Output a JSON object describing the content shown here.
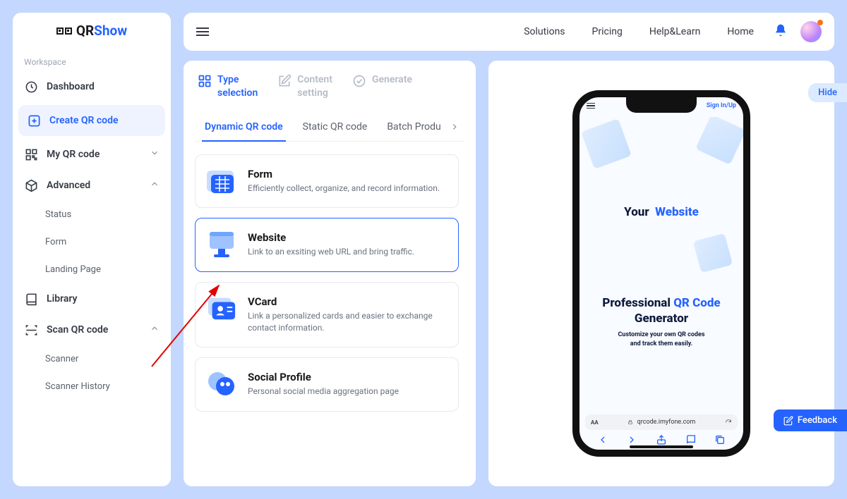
{
  "brand": {
    "name1": "QR",
    "name2": "Show"
  },
  "sidebar": {
    "workspace_label": "Workspace",
    "items": {
      "dashboard": "Dashboard",
      "create": "Create QR code",
      "myqr": "My QR code",
      "advanced": "Advanced",
      "adv_status": "Status",
      "adv_form": "Form",
      "adv_landing": "Landing Page",
      "library": "Library",
      "scan": "Scan QR code",
      "scan_scanner": "Scanner",
      "scan_history": "Scanner History"
    }
  },
  "topbar": {
    "solutions": "Solutions",
    "pricing": "Pricing",
    "help": "Help&Learn",
    "home": "Home"
  },
  "steps": {
    "s1a": "Type",
    "s1b": "selection",
    "s2a": "Content",
    "s2b": "setting",
    "s3": "Generate"
  },
  "tabs": {
    "dynamic": "Dynamic QR code",
    "static": "Static QR code",
    "batch": "Batch Produ"
  },
  "cards": {
    "form_title": "Form",
    "form_desc": "Efficiently collect, organize, and record information.",
    "website_title": "Website",
    "website_desc": "Link to an exsiting web URL and bring traffic.",
    "vcard_title": "VCard",
    "vcard_desc": "Link a personalized cards and easier to exchange contact information.",
    "social_title": "Social Profile",
    "social_desc": "Personal social media aggregation page"
  },
  "phone": {
    "signin": "Sign In/Up",
    "your": "Your",
    "website": "Website",
    "pro1": "Professional",
    "pro2": "QR Code",
    "pro3": "Generator",
    "tag1": "Customize your own QR codes",
    "tag2": "and track them easily.",
    "url_aa": "AA",
    "url": "qrcode.imyfone.com"
  },
  "hide_label": "Hide",
  "feedback_label": "Feedback"
}
